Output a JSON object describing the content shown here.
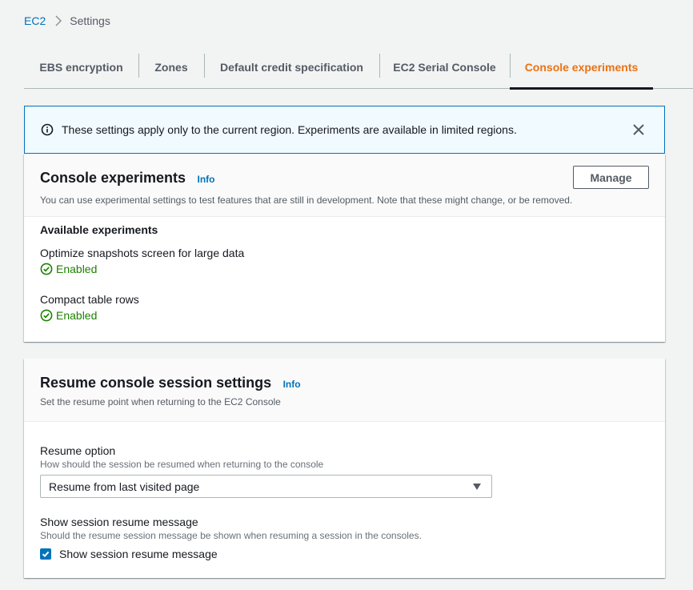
{
  "breadcrumb": {
    "root": "EC2",
    "current": "Settings"
  },
  "tabs": [
    {
      "label": "EBS encryption"
    },
    {
      "label": "Zones"
    },
    {
      "label": "Default credit specification"
    },
    {
      "label": "EC2 Serial Console"
    },
    {
      "label": "Console experiments",
      "active": true
    }
  ],
  "flash": {
    "message": "These settings apply only to the current region. Experiments are available in limited regions."
  },
  "experiments": {
    "title": "Console experiments",
    "info": "Info",
    "manage_label": "Manage",
    "description": "You can use experimental settings to test features that are still in development. Note that these might change, or be removed.",
    "list_heading": "Available experiments",
    "items": [
      {
        "name": "Optimize snapshots screen for large data",
        "status": "Enabled"
      },
      {
        "name": "Compact table rows",
        "status": "Enabled"
      }
    ]
  },
  "resume": {
    "title": "Resume console session settings",
    "info": "Info",
    "description": "Set the resume point when returning to the EC2 Console",
    "option_label": "Resume option",
    "option_description": "How should the session be resumed when returning to the console",
    "option_value": "Resume from last visited page",
    "message_label": "Show session resume message",
    "message_description": "Should the resume session message be shown when resuming a session in the consoles.",
    "checkbox_label": "Show session resume message",
    "checkbox_checked": true
  },
  "colors": {
    "accent": "#ec7211",
    "link": "#0073bb",
    "success": "#1d8102",
    "info_bg": "#f1faff"
  }
}
